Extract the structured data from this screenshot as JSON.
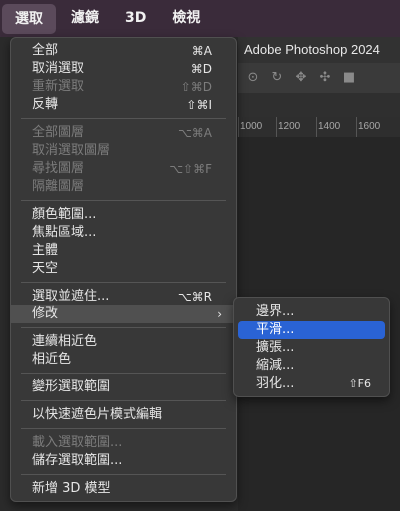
{
  "menubar": {
    "items": [
      "選取",
      "濾鏡",
      "3D",
      "檢視"
    ]
  },
  "window": {
    "title": "Adobe Photoshop 2024"
  },
  "options_bar": {
    "icons": [
      "lasso-wave-icon",
      "rotate-icon",
      "move-cross-icon",
      "pan-icon",
      "video-camera-icon"
    ]
  },
  "ruler": {
    "ticks": [
      "1000",
      "1200",
      "1400",
      "1600"
    ]
  },
  "select_menu": {
    "items": [
      {
        "label": "全部",
        "shortcut": "⌘A",
        "disabled": false
      },
      {
        "label": "取消選取",
        "shortcut": "⌘D",
        "disabled": false
      },
      {
        "label": "重新選取",
        "shortcut": "⇧⌘D",
        "disabled": true
      },
      {
        "label": "反轉",
        "shortcut": "⇧⌘I",
        "disabled": false
      },
      {
        "label": "全部圖層",
        "shortcut": "⌥⌘A",
        "disabled": true
      },
      {
        "label": "取消選取圖層",
        "shortcut": "",
        "disabled": true
      },
      {
        "label": "尋找圖層",
        "shortcut": "⌥⇧⌘F",
        "disabled": true
      },
      {
        "label": "隔離圖層",
        "shortcut": "",
        "disabled": true
      },
      {
        "label": "顏色範圍...",
        "shortcut": "",
        "disabled": false
      },
      {
        "label": "焦點區域...",
        "shortcut": "",
        "disabled": false
      },
      {
        "label": "主體",
        "shortcut": "",
        "disabled": false
      },
      {
        "label": "天空",
        "shortcut": "",
        "disabled": false
      },
      {
        "label": "選取並遮住...",
        "shortcut": "⌥⌘R",
        "disabled": false
      },
      {
        "label": "修改",
        "shortcut": "",
        "disabled": false,
        "submenu": true,
        "highlighted": true
      },
      {
        "label": "連續相近色",
        "shortcut": "",
        "disabled": false
      },
      {
        "label": "相近色",
        "shortcut": "",
        "disabled": false
      },
      {
        "label": "變形選取範圍",
        "shortcut": "",
        "disabled": false
      },
      {
        "label": "以快速遮色片模式編輯",
        "shortcut": "",
        "disabled": false
      },
      {
        "label": "載入選取範圍...",
        "shortcut": "",
        "disabled": true
      },
      {
        "label": "儲存選取範圍...",
        "shortcut": "",
        "disabled": false
      },
      {
        "label": "新增 3D 模型",
        "shortcut": "",
        "disabled": false
      }
    ]
  },
  "modify_submenu": {
    "items": [
      {
        "label": "邊界...",
        "shortcut": "",
        "selected": false
      },
      {
        "label": "平滑...",
        "shortcut": "",
        "selected": true
      },
      {
        "label": "擴張...",
        "shortcut": "",
        "selected": false
      },
      {
        "label": "縮減...",
        "shortcut": "",
        "selected": false
      },
      {
        "label": "羽化...",
        "shortcut": "⇧F6",
        "selected": false
      }
    ]
  },
  "colors": {
    "menubar_bg": "#3a2b3a",
    "selection_blue": "#2a63d4"
  }
}
